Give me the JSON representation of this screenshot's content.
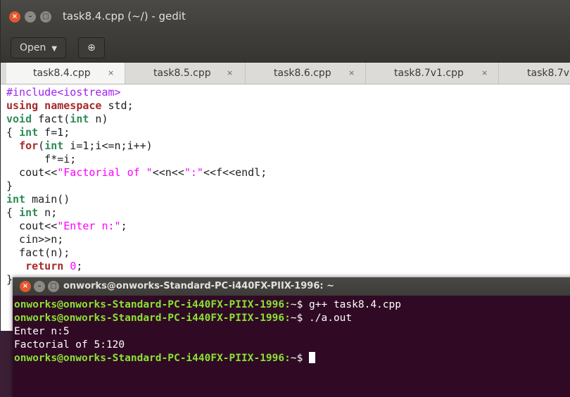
{
  "gedit": {
    "title": "task8.4.cpp (~/) - gedit",
    "toolbar": {
      "open_label": "Open",
      "new_tab_label": "⊕"
    },
    "tabs": [
      {
        "label": "task8.4.cpp",
        "close": "×"
      },
      {
        "label": "task8.5.cpp",
        "close": "×"
      },
      {
        "label": "task8.6.cpp",
        "close": "×"
      },
      {
        "label": "task8.7v1.cpp",
        "close": "×"
      },
      {
        "label": "task8.7v",
        "close": ""
      }
    ],
    "code": {
      "l1": "#include<iostream>",
      "l2_kw": "using namespace",
      "l2_rest": " std;",
      "l3_ty": "void",
      "l3_a": " fact(",
      "l3_ty2": "int",
      "l3_b": " n)",
      "l4_a": "{ ",
      "l4_ty": "int",
      "l4_b": " f=1;",
      "l5_a": "  ",
      "l5_kw": "for",
      "l5_b": "(",
      "l5_ty": "int",
      "l5_c": " i=1;i<=n;i++)",
      "l6": "      f*=i;",
      "l7_a": "  cout<<",
      "l7_st": "\"Factorial of \"",
      "l7_b": "<<n<<",
      "l7_st2": "\":\"",
      "l7_c": "<<f<<endl;",
      "l8": "}",
      "l9_ty": "int",
      "l9_b": " main()",
      "l10_a": "{ ",
      "l10_ty": "int",
      "l10_b": " n;",
      "l11_a": "  cout<<",
      "l11_st": "\"Enter n:\"",
      "l11_b": ";",
      "l12": "  cin>>n;",
      "l13": "  fact(n);",
      "l14_a": "   ",
      "l14_kw": "return",
      "l14_nm": "0",
      "l14_b": ";",
      "l15": "}"
    }
  },
  "terminal": {
    "title": "onworks@onworks-Standard-PC-i440FX-PIIX-1996: ~",
    "lines": [
      {
        "prompt": "onworks@onworks-Standard-PC-i440FX-PIIX-1996:",
        "rest": "~$ g++ task8.4.cpp"
      },
      {
        "prompt": "onworks@onworks-Standard-PC-i440FX-PIIX-1996:",
        "rest": "~$ ./a.out"
      },
      {
        "output": "Enter n:5"
      },
      {
        "output": "Factorial of 5:120"
      },
      {
        "prompt": "onworks@onworks-Standard-PC-i440FX-PIIX-1996:",
        "rest": "~$ "
      }
    ]
  },
  "colors": {
    "terminal_bg": "#300a24",
    "prompt_green": "#8ae234",
    "close_button": "#e2572e",
    "preprocessor": "#a020f0",
    "keyword": "#a52a2a",
    "type": "#2e8b57",
    "string": "#ff00ff"
  }
}
